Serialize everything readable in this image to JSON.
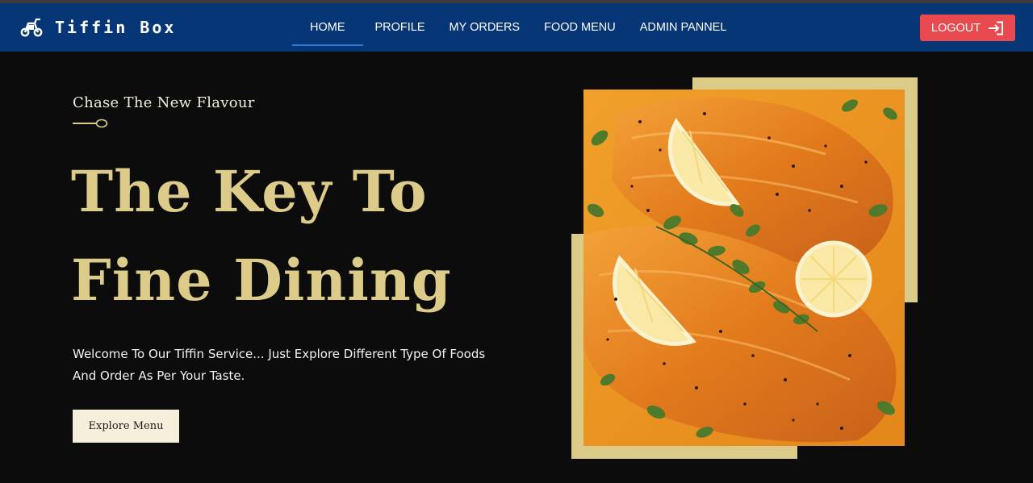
{
  "brand": {
    "name": "Tiffin Box",
    "icon": "scooter-icon"
  },
  "nav": {
    "items": [
      {
        "label": "HOME",
        "active": true
      },
      {
        "label": "PROFILE",
        "active": false
      },
      {
        "label": "MY ORDERS",
        "active": false
      },
      {
        "label": "FOOD MENU",
        "active": false
      },
      {
        "label": "ADMIN PANNEL",
        "active": false
      }
    ],
    "logout": {
      "label": "LOGOUT",
      "icon": "logout-icon"
    }
  },
  "hero": {
    "tagline": "Chase The New Flavour",
    "title_line1": "The Key To",
    "title_line2": "Fine Dining",
    "description": "Welcome To Our Tiffin Service... Just Explore Different Type Of Foods And Order As Per Your Taste.",
    "cta": "Explore Menu",
    "image": "grilled-salmon-with-lemon"
  },
  "colors": {
    "navbar": "#063675",
    "background": "#0c0c0d",
    "gold": "#dccb89",
    "logout": "#e84a50",
    "cta_background": "#f6efdc"
  }
}
